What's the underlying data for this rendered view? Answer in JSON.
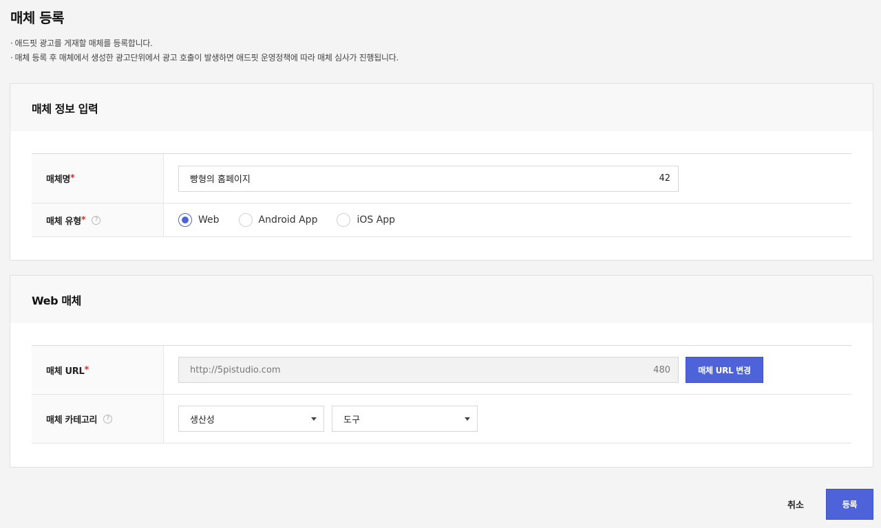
{
  "page": {
    "title": "매체 등록",
    "notes": [
      "애드핏 광고를 게재할 매체를 등록합니다.",
      "매체 등록 후 매체에서 생성한 광고단위에서 광고 호출이 발생하면 애드핏 운영정책에 따라 매체 심사가 진행됩니다."
    ]
  },
  "media_info": {
    "header": "매체 정보 입력",
    "name_label": "매체명",
    "name_value": "빵형의 홈페이지",
    "name_counter": "42",
    "type_label": "매체 유형",
    "type_options": [
      {
        "label": "Web",
        "checked": true
      },
      {
        "label": "Android App",
        "checked": false
      },
      {
        "label": "iOS App",
        "checked": false
      }
    ],
    "required_mark": "*"
  },
  "web_media": {
    "header": "Web 매체",
    "url_label": "매체 URL",
    "url_value": "http://5pistudio.com",
    "url_counter": "480",
    "change_url_button": "매체 URL 변경",
    "category_label": "매체 카테고리",
    "category_primary": "생산성",
    "category_secondary": "도구"
  },
  "footer": {
    "cancel": "취소",
    "submit": "등록"
  },
  "colors": {
    "accent": "#4e63d9",
    "required": "#d32f2f"
  }
}
